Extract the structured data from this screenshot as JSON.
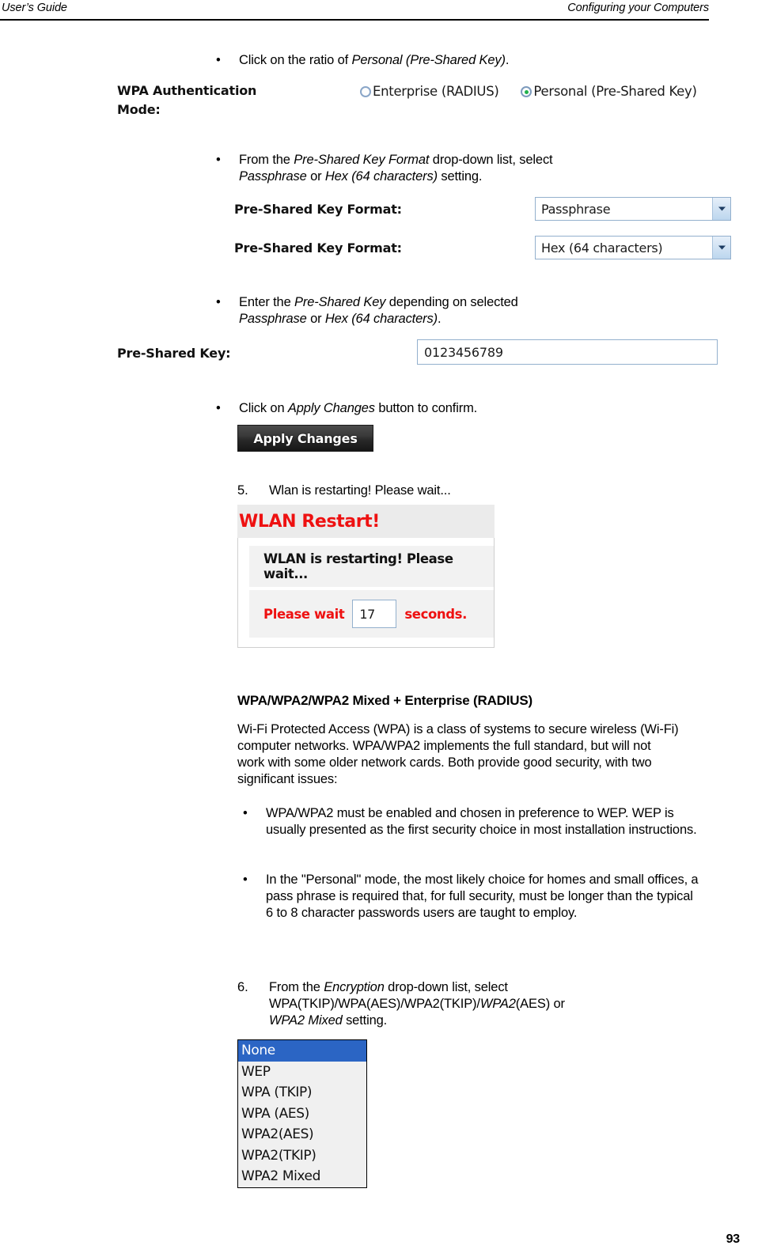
{
  "header": {
    "left_title": "User’s Guide",
    "right_title": "Configuring your Computers"
  },
  "steps": {
    "bullet_click_ratio": {
      "marker": "•",
      "text_before": "Click on the ratio of ",
      "text_italic": "Personal (Pre-Shared Key)",
      "text_after": "."
    },
    "bullet_key_format": {
      "marker": "•",
      "line1_a": "From the ",
      "line1_i": "Pre-Shared Key Format",
      "line1_b": " drop-down list, select",
      "line2_i1": "Passphrase",
      "line2_a": " or ",
      "line2_i2": "Hex (64 characters)",
      "line2_b": " setting."
    },
    "bullet_enter_key": {
      "marker": "•",
      "line1_a": "Enter the ",
      "line1_i": "Pre-Shared Key",
      "line1_b": " depending on selected",
      "line2_i1": "Passphrase",
      "line2_a": " or ",
      "line2_i2": "Hex (64 characters)",
      "line2_b": "."
    },
    "bullet_apply": {
      "marker": "•",
      "text_before": "Click on ",
      "text_italic": "Apply Changes",
      "text_after": " button to confirm."
    },
    "step5": {
      "number": "5.",
      "text": "Wlan is restarting! Please wait..."
    },
    "step6": {
      "number": "6.",
      "line1_a": "From the ",
      "line1_i": "Encryption",
      "line1_b": " drop-down list, select",
      "line2_a": "WPA(TKIP)/WPA(AES)/WPA2(TKIP)/",
      "line2_i": "WPA2",
      "line2_b": "(AES) or",
      "line3_i": "WPA2 Mixed",
      "line3_b": " setting."
    }
  },
  "wpa_auth_mode": {
    "label_line1": "WPA Authentication",
    "label_line2": "Mode:",
    "options": [
      {
        "label": "Enterprise (RADIUS)",
        "selected": false
      },
      {
        "label": "Personal (Pre-Shared Key)",
        "selected": true
      }
    ]
  },
  "key_format_rows": [
    {
      "label": "Pre-Shared Key Format:",
      "value": "Passphrase"
    },
    {
      "label": "Pre-Shared Key Format:",
      "value": "Hex (64 characters)"
    }
  ],
  "pre_shared_key": {
    "label": "Pre-Shared Key:",
    "value": "0123456789"
  },
  "apply_button": {
    "label": "Apply Changes"
  },
  "wlan_restart": {
    "title": "WLAN Restart!",
    "message": "WLAN is restarting! Please wait...",
    "wait_prefix": "Please wait",
    "seconds_value": "17",
    "wait_suffix": "seconds."
  },
  "section": {
    "heading": "WPA/WPA2/WPA2 Mixed + Enterprise (RADIUS)",
    "paragraph": "Wi-Fi Protected Access (WPA) is a class of systems to secure wireless (Wi-Fi) computer networks. WPA/WPA2 implements the full standard, but will not work with some older network cards. Both provide good security, with two significant issues:",
    "bullets": [
      "WPA/WPA2 must be enabled and chosen in preference to WEP. WEP is usually presented as the first security choice in most installation instructions.",
      "In the \"Personal\" mode, the most likely choice for homes and small offices, a pass phrase is required that, for full security, must be longer than the typical 6 to 8 character passwords users are taught to employ."
    ]
  },
  "encryption_listbox": {
    "options": [
      {
        "label": "None",
        "selected": true
      },
      {
        "label": "WEP",
        "selected": false
      },
      {
        "label": "WPA (TKIP)",
        "selected": false
      },
      {
        "label": "WPA (AES)",
        "selected": false
      },
      {
        "label": "WPA2(AES)",
        "selected": false
      },
      {
        "label": "WPA2(TKIP)",
        "selected": false
      },
      {
        "label": "WPA2 Mixed",
        "selected": false
      }
    ]
  },
  "footer": {
    "page_number": "93"
  },
  "colors": {
    "selected_radio_dot": "#22b14c",
    "alert_red": "#ee1111",
    "listbox_highlight": "#2b65c4",
    "field_border": "#93b0cd"
  }
}
